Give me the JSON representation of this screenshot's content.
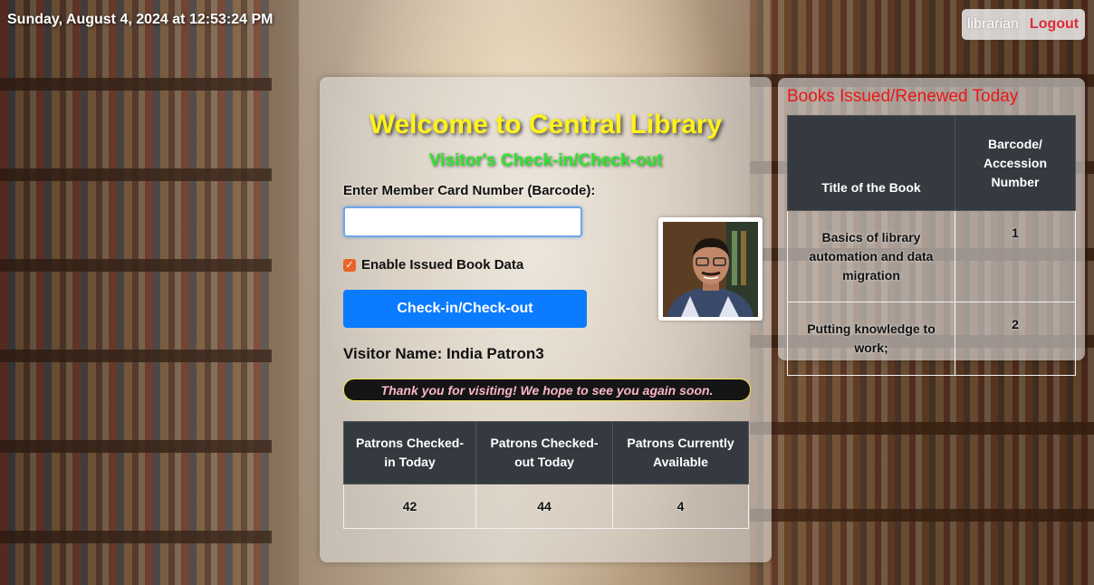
{
  "header": {
    "datetime": "Sunday, August 4, 2024 at 12:53:24 PM",
    "username": "librarian",
    "logout_label": "Logout"
  },
  "main": {
    "title": "Welcome to Central Library",
    "subtitle": "Visitor's Check-in/Check-out",
    "card_label": "Enter Member Card Number (Barcode):",
    "card_value": "",
    "enable_label": "Enable Issued Book Data",
    "enable_checked": true,
    "button_label": "Check-in/Check-out",
    "visitor_name": "Visitor Name: India Patron3",
    "thanks_message": "Thank you for visiting! We hope to see you again soon.",
    "stats": {
      "headers": [
        "Patrons Checked-in Today",
        "Patrons Checked-out Today",
        "Patrons Currently Available"
      ],
      "values": [
        "42",
        "44",
        "4"
      ]
    }
  },
  "side": {
    "title": "Books Issued/Renewed Today",
    "headers": [
      "Title of the Book",
      "Barcode/ Accession Number"
    ],
    "rows": [
      {
        "title": "Basics of library automation and data migration",
        "barcode": "1"
      },
      {
        "title": "Putting knowledge to work;",
        "barcode": "2"
      }
    ]
  },
  "colors": {
    "title": "#fff21a",
    "subtitle": "#2ce52c",
    "button": "#0b7bff",
    "logout": "#e02a3a",
    "side_title": "#e81818",
    "table_header": "#343a40"
  }
}
